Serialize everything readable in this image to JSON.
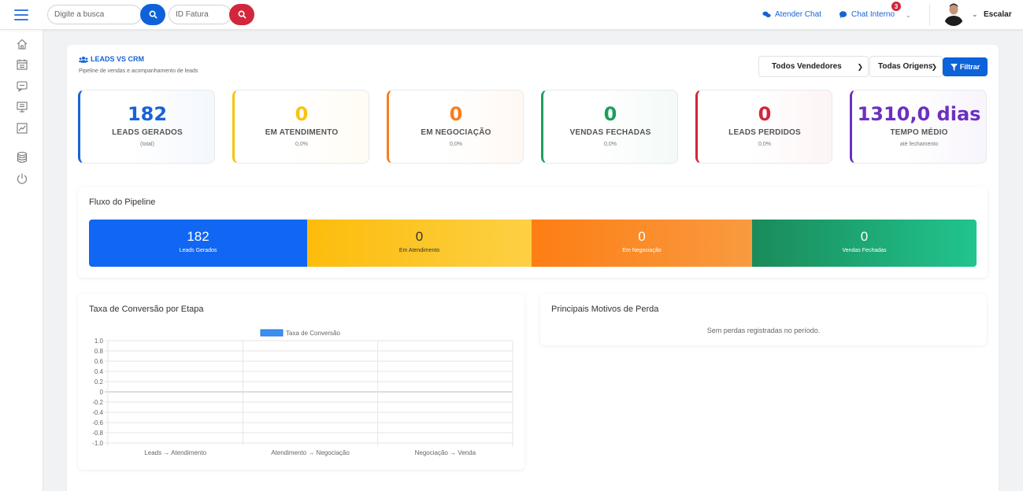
{
  "topbar": {
    "search_placeholder": "Digite a busca",
    "invoice_placeholder": "ID Fatura",
    "atender_chat": "Atender Chat",
    "chat_interno": "Chat Interno",
    "chat_badge": "3",
    "user_name": "Escalar"
  },
  "sidebar": {
    "icons": [
      "home-icon",
      "calendar-icon",
      "message-icon",
      "monitor-icon",
      "chart-line-icon",
      "database-icon",
      "power-icon"
    ]
  },
  "page": {
    "title": "LEADS VS CRM",
    "subtitle": "Pipeline de vendas e acompanhamento de leads"
  },
  "filters": {
    "vendedores": "Todos Vendedores",
    "origens": "Todas Origens",
    "filter_label": "Filtrar"
  },
  "colors": {
    "blue": "#1763d6",
    "yellow": "#f8c30a",
    "orange": "#fb8c2a",
    "green": "#1d9f5c",
    "red": "#d2263c",
    "purple": "#6b30c0"
  },
  "kpis": [
    {
      "value": "182",
      "label": "LEADS GERADOS",
      "sub": "(total)",
      "color": "#1763d6"
    },
    {
      "value": "0",
      "label": "EM ATENDIMENTO",
      "sub": "0,0%",
      "color": "#f8c30a"
    },
    {
      "value": "0",
      "label": "EM NEGOCIAÇÃO",
      "sub": "0,0%",
      "color": "#fb7d1c"
    },
    {
      "value": "0",
      "label": "VENDAS FECHADAS",
      "sub": "0,0%",
      "color": "#1d9f5c"
    },
    {
      "value": "0",
      "label": "LEADS PERDIDOS",
      "sub": "0,0%",
      "color": "#d2263c"
    },
    {
      "value": "1310,0 dias",
      "label": "TEMPO MÉDIO",
      "sub": "até fechamento",
      "color": "#6b30c0"
    }
  ],
  "pipeline": {
    "title": "Fluxo do Pipeline",
    "segments": [
      {
        "value": "182",
        "label": "Leads Gerados"
      },
      {
        "value": "0",
        "label": "Em Atendimento"
      },
      {
        "value": "0",
        "label": "Em Negociação"
      },
      {
        "value": "0",
        "label": "Vendas Fechadas"
      }
    ]
  },
  "conversion": {
    "title": "Taxa de Conversão por Etapa"
  },
  "losses": {
    "title": "Principais Motivos de Perda",
    "empty": "Sem perdas registradas no período."
  },
  "chart_data": {
    "type": "bar",
    "title": "",
    "categories": [
      "Leads → Atendimento",
      "Atendimento → Negociação",
      "Negociação → Venda"
    ],
    "series": [
      {
        "name": "Taxa de Conversão",
        "values": [
          0,
          0,
          0
        ]
      }
    ],
    "ylim": [
      -1.0,
      1.0
    ],
    "yticks": [
      "1.0",
      "0.8",
      "0.6",
      "0.4",
      "0.2",
      "0",
      "-0.2",
      "-0.4",
      "-0.6",
      "-0.8",
      "-1.0"
    ],
    "grid": true,
    "legend": "top",
    "color": "#3b8ff0"
  }
}
